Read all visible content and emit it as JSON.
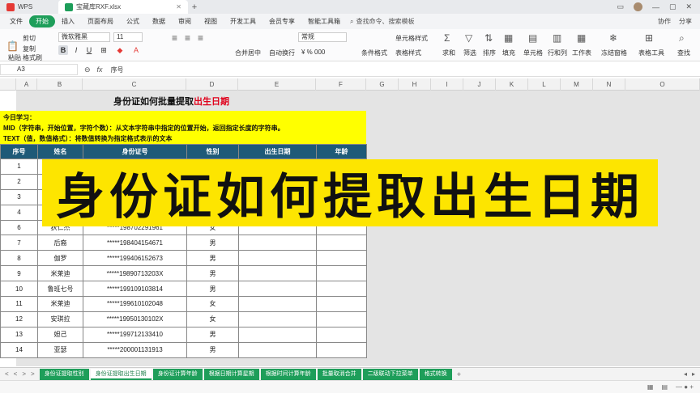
{
  "titlebar": {
    "tabs": [
      {
        "label": "WPS"
      },
      {
        "label": "宝藏库RXF.xlsx"
      }
    ],
    "new_tab": "+",
    "controls": [
      "▭",
      "—",
      "▢",
      "✕"
    ]
  },
  "menubar": {
    "file": "文件",
    "items": [
      "开始",
      "插入",
      "页面布局",
      "公式",
      "数据",
      "审阅",
      "视图",
      "开发工具",
      "会员专享",
      "智能工具箱"
    ],
    "active_index": 0,
    "search": "查找命令、搜索模板",
    "right": [
      "协作",
      "分享"
    ]
  },
  "ribbon": {
    "cut": "剪切",
    "paste": "粘贴",
    "copy": "复制",
    "format_painter": "格式刷",
    "font_name": "微软雅黑",
    "font_size": "11",
    "merge": "合并居中",
    "wrap": "自动换行",
    "number_format": "常规",
    "conditional": "条件格式",
    "cell_style": "单元格样式",
    "table_style": "表格样式",
    "sum": "求和",
    "filter": "筛选",
    "sort": "排序",
    "fill": "填充",
    "cells": "单元格",
    "rows_cols": "行和列",
    "worksheet": "工作表",
    "freeze": "冻结窗格",
    "table_tools": "表格工具",
    "find": "查找"
  },
  "formulabar": {
    "cell_ref": "A3",
    "fx": "fx",
    "content": "序号"
  },
  "columns": [
    "A",
    "B",
    "C",
    "D",
    "E",
    "F",
    "G",
    "H",
    "I",
    "J",
    "K",
    "L",
    "M",
    "N",
    "O"
  ],
  "rows": [
    "1",
    "2",
    "3",
    "4",
    "5",
    "6",
    "7",
    "8",
    "9",
    "10",
    "11",
    "12",
    "13",
    "14",
    "15",
    "16",
    "17",
    "18"
  ],
  "sheet": {
    "title_main": "身份证如何批量提取",
    "title_red": "出生日期",
    "notes": {
      "line1": "今日学习：",
      "line2": "MID（字符串，开始位置，字符个数）：从文本字符串中指定的位置开始，返回指定长度的字符串。",
      "line3": "TEXT（值，数值格式）：将数值转换为指定格式表示的文本"
    },
    "headers": [
      "序号",
      "姓名",
      "身份证号",
      "性别",
      "出生日期",
      "年龄"
    ],
    "rows": [
      {
        "no": "1",
        "name": "",
        "id": "",
        "gender": ""
      },
      {
        "no": "2",
        "name": "",
        "id": "",
        "gender": ""
      },
      {
        "no": "3",
        "name": "",
        "id": "",
        "gender": ""
      },
      {
        "no": "4",
        "name": "",
        "id": "",
        "gender": ""
      },
      {
        "no": "6",
        "name": "狄仁杰",
        "id": "*****198702291961",
        "gender": "女"
      },
      {
        "no": "7",
        "name": "后裔",
        "id": "*****198404154671",
        "gender": "男"
      },
      {
        "no": "8",
        "name": "伽罗",
        "id": "*****199406152673",
        "gender": "男"
      },
      {
        "no": "9",
        "name": "米莱迪",
        "id": "*****19890713203X",
        "gender": "男"
      },
      {
        "no": "10",
        "name": "鲁班七号",
        "id": "*****199109103814",
        "gender": "男"
      },
      {
        "no": "11",
        "name": "米莱迪",
        "id": "*****199610102048",
        "gender": "女"
      },
      {
        "no": "12",
        "name": "安琪拉",
        "id": "*****19950130102X",
        "gender": "女"
      },
      {
        "no": "13",
        "name": "妲己",
        "id": "*****199712133410",
        "gender": "男"
      },
      {
        "no": "14",
        "name": "亚瑟",
        "id": "*****200001131913",
        "gender": "男"
      }
    ]
  },
  "banner": "身份证如何提取出生日期",
  "sheet_tabs": [
    "身份证提取性别",
    "身份证提取出生日期",
    "身份证计算年龄",
    "根据日期计算星期",
    "根据时间计算年龄",
    "批量取消合并",
    "二级联动下拉菜单",
    "格式转换"
  ],
  "active_sheet_index": 1,
  "colors": {
    "accent": "#1e9e5a",
    "header_bg": "#1f5a78",
    "highlight": "#ffff00",
    "banner": "#fde500",
    "red": "#e0001b"
  }
}
